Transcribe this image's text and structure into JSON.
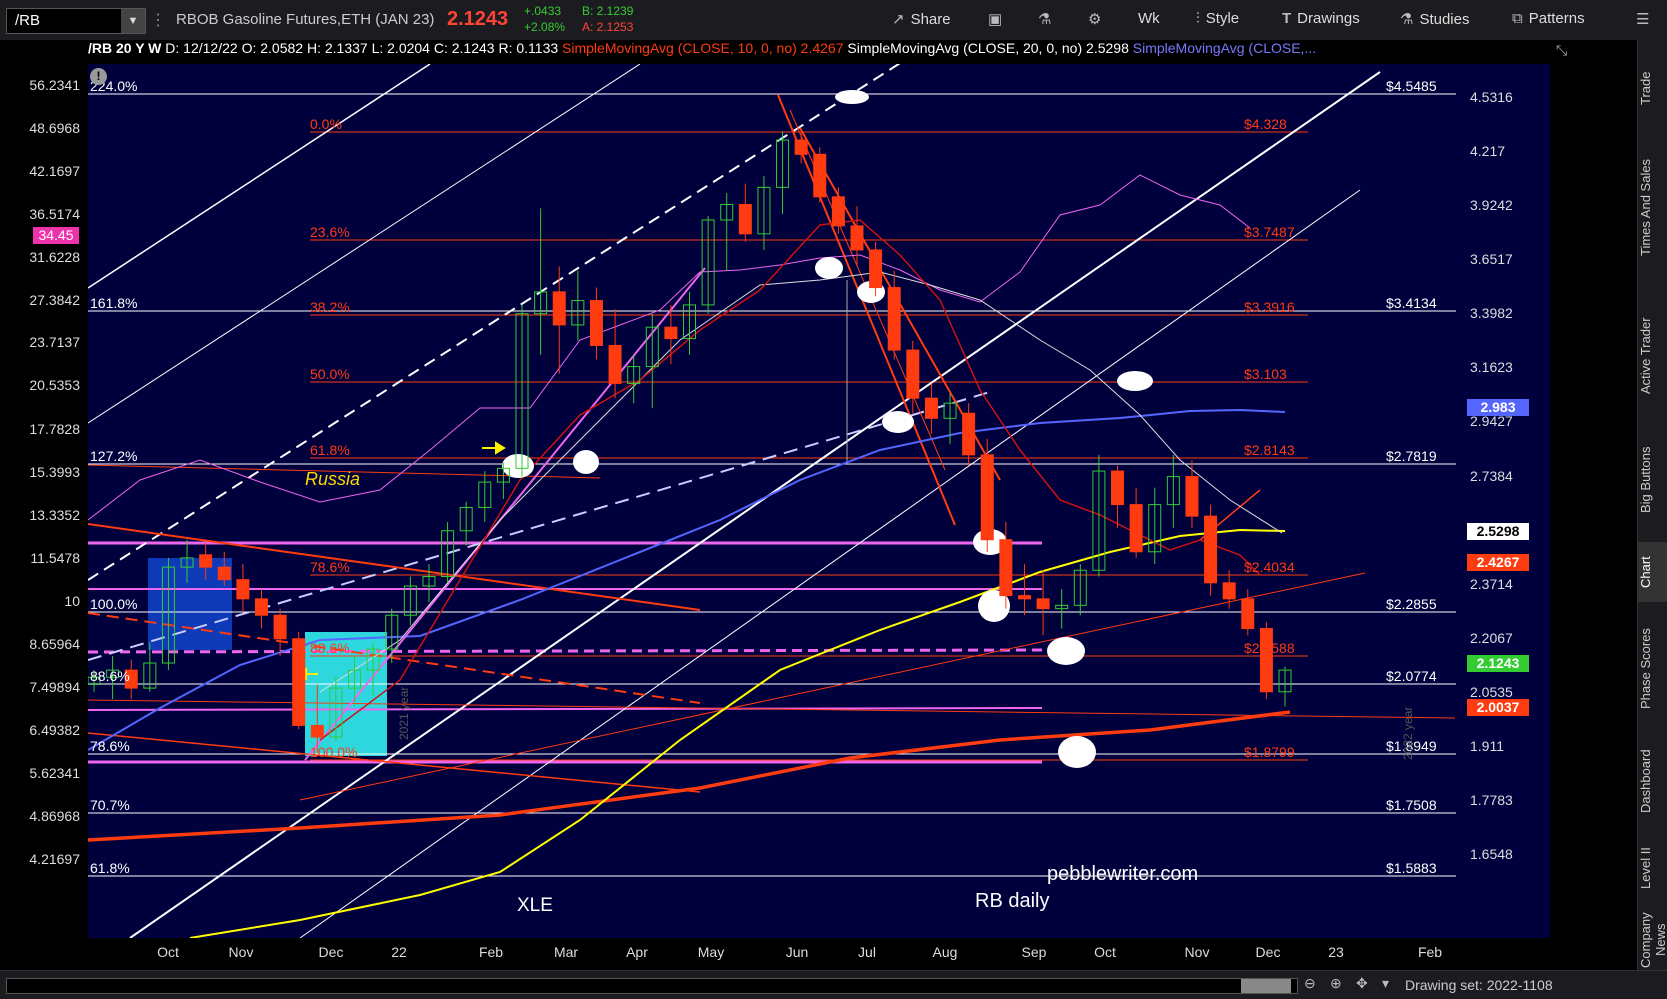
{
  "toolbar": {
    "symbol": "/RB",
    "description": "RBOB Gasoline Futures,ETH (JAN 23)",
    "last": "2.1243",
    "change": "+.0433",
    "change_pct": "+2.08%",
    "bid": "B: 2.1239",
    "ask": "A: 2.1253",
    "share": "Share",
    "wk": "Wk",
    "style": "Style",
    "drawings": "Drawings",
    "studies": "Studies",
    "patterns": "Patterns"
  },
  "infobar": {
    "period": "/RB 20 Y W",
    "date": "D: 12/12/22",
    "open": "O: 2.0582",
    "high": "H: 2.1337",
    "low": "L: 2.0204",
    "close": "C: 2.1243",
    "range": "R: 0.1133",
    "sma10": "SimpleMovingAvg (CLOSE, 10, 0, no)",
    "sma10_val": "2.4267",
    "sma20": "SimpleMovingAvg (CLOSE, 20, 0, no)",
    "sma20_val": "2.5298",
    "sma3": "SimpleMovingAvg (CLOSE,..."
  },
  "side_tabs": [
    "Trade",
    "Times And Sales",
    "Active Trader",
    "Big Buttons",
    "Chart",
    "Phase Scores",
    "Dashboard",
    "Level II",
    "Company News"
  ],
  "bottom": {
    "drawing_set": "Drawing set: 2022-1108"
  },
  "colors": {
    "bg": "#00003c",
    "up": "#33cc33",
    "down": "#ff3b10",
    "fib_orange": "#ff3b10",
    "yellow_ma": "#ffff00",
    "violet": "#ee66ee",
    "blue_ma": "#5566ff"
  },
  "chart_data": {
    "type": "candlestick",
    "title": "pebblewriter.com RB daily",
    "annotations": [
      "Russia",
      "XLE",
      "2021 year",
      "2022 year"
    ],
    "x_months": [
      "Oct",
      "Nov",
      "Dec",
      "22",
      "Feb",
      "Mar",
      "Apr",
      "May",
      "Jun",
      "Jul",
      "Aug",
      "Sep",
      "Oct",
      "Nov",
      "Dec",
      "23",
      "Feb"
    ],
    "left_axis": [
      "56.2341",
      "48.6968",
      "42.1697",
      "36.5174",
      "31.6228",
      "27.3842",
      "23.7137",
      "20.5353",
      "17.7828",
      "15.3993",
      "13.3352",
      "11.5478",
      "10",
      "8.65964",
      "7.49894",
      "6.49382",
      "5.62341",
      "4.86968",
      "4.21697"
    ],
    "left_marker": "34.45",
    "right_axis": [
      "4.5316",
      "4.217",
      "3.9242",
      "3.6517",
      "3.3982",
      "3.1623",
      "2.9427",
      "2.7384",
      "2.5483",
      "2.3714",
      "2.2067",
      "2.0535",
      "1.911",
      "1.7783",
      "1.6548"
    ],
    "right_markers": [
      {
        "label": "2.983",
        "color": "#5566ff"
      },
      {
        "label": "2.5298",
        "color": "#ffffff"
      },
      {
        "label": "2.4267",
        "color": "#ff3b10"
      },
      {
        "label": "2.1243",
        "color": "#33cc33"
      },
      {
        "label": "2.0037",
        "color": "#ff3b10"
      }
    ],
    "white_levels": [
      {
        "left": "224.0%",
        "right": "$4.5485"
      },
      {
        "left": "161.8%",
        "right": "$3.4134"
      },
      {
        "left": "127.2%",
        "right": "$2.7819"
      },
      {
        "left": "100.0%",
        "right": "$2.2855"
      },
      {
        "left": "88.6%",
        "right": "$2.0774"
      },
      {
        "left": "78.6%",
        "right": "$1.8949"
      },
      {
        "left": "70.7%",
        "right": "$1.7508"
      },
      {
        "left": "61.8%",
        "right": "$1.5883"
      }
    ],
    "fib_levels": [
      {
        "label": "0.0%",
        "price": "$4.328"
      },
      {
        "label": "23.6%",
        "price": "$3.7487"
      },
      {
        "label": "38.2%",
        "price": "$3.3916"
      },
      {
        "label": "50.0%",
        "price": "$3.103"
      },
      {
        "label": "61.8%",
        "price": "$2.8143"
      },
      {
        "label": "78.6%",
        "price": "$2.4034"
      },
      {
        "label": "88.6%",
        "price": "$2.1588"
      },
      {
        "label": "100.0%",
        "price": "$1.8799"
      }
    ],
    "candles": [
      {
        "t": "Sep 20",
        "o": 2.08,
        "h": 2.12,
        "l": 2.06,
        "c": 2.1
      },
      {
        "t": "Sep 27",
        "o": 2.1,
        "h": 2.16,
        "l": 2.04,
        "c": 2.12
      },
      {
        "t": "Oct 04",
        "o": 2.12,
        "h": 2.15,
        "l": 2.04,
        "c": 2.07
      },
      {
        "t": "Oct 11",
        "o": 2.07,
        "h": 2.2,
        "l": 2.06,
        "c": 2.14
      },
      {
        "t": "Oct 18",
        "o": 2.14,
        "h": 2.46,
        "l": 2.12,
        "c": 2.43
      },
      {
        "t": "Oct 25",
        "o": 2.43,
        "h": 2.52,
        "l": 2.38,
        "c": 2.46
      },
      {
        "t": "Nov 01",
        "o": 2.47,
        "h": 2.51,
        "l": 2.39,
        "c": 2.43
      },
      {
        "t": "Nov 08",
        "o": 2.43,
        "h": 2.48,
        "l": 2.37,
        "c": 2.39
      },
      {
        "t": "Nov 15",
        "o": 2.39,
        "h": 2.44,
        "l": 2.29,
        "c": 2.33
      },
      {
        "t": "Nov 22",
        "o": 2.33,
        "h": 2.36,
        "l": 2.24,
        "c": 2.28
      },
      {
        "t": "Nov 29",
        "o": 2.28,
        "h": 2.3,
        "l": 2.16,
        "c": 2.21
      },
      {
        "t": "Dec 06",
        "o": 2.21,
        "h": 2.23,
        "l": 1.96,
        "c": 1.97
      },
      {
        "t": "Dec 13",
        "o": 1.97,
        "h": 2.08,
        "l": 1.9,
        "c": 1.94
      },
      {
        "t": "Dec 20",
        "o": 1.94,
        "h": 2.1,
        "l": 1.93,
        "c": 2.07
      },
      {
        "t": "Dec 27",
        "o": 2.07,
        "h": 2.16,
        "l": 2.02,
        "c": 2.12
      },
      {
        "t": "Jan 03",
        "o": 2.12,
        "h": 2.2,
        "l": 2.05,
        "c": 2.18
      },
      {
        "t": "Jan 10",
        "o": 2.18,
        "h": 2.3,
        "l": 2.14,
        "c": 2.28
      },
      {
        "t": "Jan 17",
        "o": 2.28,
        "h": 2.4,
        "l": 2.25,
        "c": 2.37
      },
      {
        "t": "Jan 24",
        "o": 2.37,
        "h": 2.44,
        "l": 2.32,
        "c": 2.4
      },
      {
        "t": "Jan 31",
        "o": 2.4,
        "h": 2.58,
        "l": 2.38,
        "c": 2.55
      },
      {
        "t": "Feb 07",
        "o": 2.55,
        "h": 2.65,
        "l": 2.5,
        "c": 2.63
      },
      {
        "t": "Feb 14",
        "o": 2.63,
        "h": 2.76,
        "l": 2.58,
        "c": 2.72
      },
      {
        "t": "Feb 21",
        "o": 2.72,
        "h": 2.79,
        "l": 2.66,
        "c": 2.77
      },
      {
        "t": "Feb 28",
        "o": 2.77,
        "h": 3.44,
        "l": 2.74,
        "c": 3.4
      },
      {
        "t": "Mar 07",
        "o": 3.4,
        "h": 3.91,
        "l": 3.22,
        "c": 3.5
      },
      {
        "t": "Mar 14",
        "o": 3.5,
        "h": 3.62,
        "l": 3.14,
        "c": 3.35
      },
      {
        "t": "Mar 21",
        "o": 3.35,
        "h": 3.6,
        "l": 3.28,
        "c": 3.46
      },
      {
        "t": "Mar 28",
        "o": 3.46,
        "h": 3.52,
        "l": 3.2,
        "c": 3.26
      },
      {
        "t": "Apr 04",
        "o": 3.26,
        "h": 3.42,
        "l": 3.04,
        "c": 3.1
      },
      {
        "t": "Apr 11",
        "o": 3.1,
        "h": 3.22,
        "l": 3.02,
        "c": 3.17
      },
      {
        "t": "Apr 18",
        "o": 3.17,
        "h": 3.4,
        "l": 3.0,
        "c": 3.34
      },
      {
        "t": "Apr 25",
        "o": 3.34,
        "h": 3.44,
        "l": 3.18,
        "c": 3.29
      },
      {
        "t": "May 02",
        "o": 3.29,
        "h": 3.5,
        "l": 3.22,
        "c": 3.44
      },
      {
        "t": "May 09",
        "o": 3.44,
        "h": 3.87,
        "l": 3.4,
        "c": 3.85
      },
      {
        "t": "May 16",
        "o": 3.85,
        "h": 3.99,
        "l": 3.6,
        "c": 3.93
      },
      {
        "t": "May 23",
        "o": 3.93,
        "h": 4.04,
        "l": 3.74,
        "c": 3.78
      },
      {
        "t": "May 30",
        "o": 3.78,
        "h": 4.08,
        "l": 3.7,
        "c": 4.02
      },
      {
        "t": "Jun 06",
        "o": 4.02,
        "h": 4.33,
        "l": 3.88,
        "c": 4.28
      },
      {
        "t": "Jun 13",
        "o": 4.28,
        "h": 4.32,
        "l": 4.15,
        "c": 4.2
      },
      {
        "t": "Jun 20",
        "o": 4.2,
        "h": 4.24,
        "l": 3.94,
        "c": 3.97
      },
      {
        "t": "Jun 27",
        "o": 3.97,
        "h": 4.02,
        "l": 3.78,
        "c": 3.82
      },
      {
        "t": "Jul 04",
        "o": 3.82,
        "h": 3.92,
        "l": 3.62,
        "c": 3.7
      },
      {
        "t": "Jul 11",
        "o": 3.7,
        "h": 3.74,
        "l": 3.48,
        "c": 3.52
      },
      {
        "t": "Jul 18",
        "o": 3.52,
        "h": 3.6,
        "l": 3.2,
        "c": 3.24
      },
      {
        "t": "Jul 25",
        "o": 3.24,
        "h": 3.28,
        "l": 2.98,
        "c": 3.04
      },
      {
        "t": "Aug 01",
        "o": 3.04,
        "h": 3.1,
        "l": 2.9,
        "c": 2.96
      },
      {
        "t": "Aug 08",
        "o": 2.96,
        "h": 3.06,
        "l": 2.86,
        "c": 3.02
      },
      {
        "t": "Aug 15",
        "o": 2.98,
        "h": 3.02,
        "l": 2.78,
        "c": 2.82
      },
      {
        "t": "Aug 22",
        "o": 2.82,
        "h": 2.88,
        "l": 2.48,
        "c": 2.52
      },
      {
        "t": "Aug 29",
        "o": 2.52,
        "h": 2.58,
        "l": 2.3,
        "c": 2.34
      },
      {
        "t": "Sep 05",
        "o": 2.34,
        "h": 2.44,
        "l": 2.28,
        "c": 2.33
      },
      {
        "t": "Sep 12",
        "o": 2.33,
        "h": 2.42,
        "l": 2.22,
        "c": 2.3
      },
      {
        "t": "Sep 19",
        "o": 2.3,
        "h": 2.36,
        "l": 2.24,
        "c": 2.31
      },
      {
        "t": "Sep 26",
        "o": 2.31,
        "h": 2.44,
        "l": 2.28,
        "c": 2.42
      },
      {
        "t": "Oct 03",
        "o": 2.42,
        "h": 2.82,
        "l": 2.4,
        "c": 2.76
      },
      {
        "t": "Oct 10",
        "o": 2.76,
        "h": 2.78,
        "l": 2.56,
        "c": 2.64
      },
      {
        "t": "Oct 17",
        "o": 2.64,
        "h": 2.7,
        "l": 2.46,
        "c": 2.48
      },
      {
        "t": "Oct 24",
        "o": 2.48,
        "h": 2.7,
        "l": 2.44,
        "c": 2.64
      },
      {
        "t": "Oct 31",
        "o": 2.64,
        "h": 2.82,
        "l": 2.56,
        "c": 2.74
      },
      {
        "t": "Nov 07",
        "o": 2.74,
        "h": 2.8,
        "l": 2.56,
        "c": 2.6
      },
      {
        "t": "Nov 14",
        "o": 2.6,
        "h": 2.64,
        "l": 2.34,
        "c": 2.38
      },
      {
        "t": "Nov 21",
        "o": 2.38,
        "h": 2.42,
        "l": 2.3,
        "c": 2.33
      },
      {
        "t": "Nov 28",
        "o": 2.33,
        "h": 2.36,
        "l": 2.22,
        "c": 2.24
      },
      {
        "t": "Dec 05",
        "o": 2.24,
        "h": 2.26,
        "l": 2.04,
        "c": 2.06
      },
      {
        "t": "Dec 12",
        "o": 2.06,
        "h": 2.13,
        "l": 2.02,
        "c": 2.12
      }
    ]
  }
}
